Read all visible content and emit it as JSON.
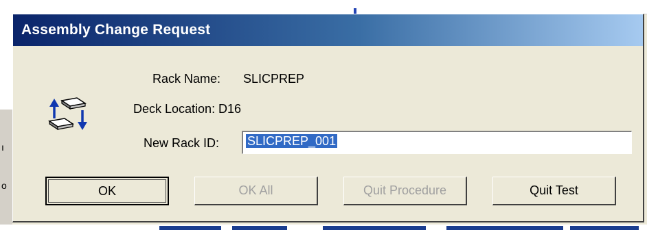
{
  "dialog": {
    "title": "Assembly Change Request",
    "fields": {
      "rack_name_label": "Rack Name:",
      "rack_name_value": "SLICPREP",
      "deck_location_label": "Deck Location:",
      "deck_location_value": "D16",
      "new_rack_id_label": "New Rack ID:",
      "new_rack_id_value": "SLICPREP_001"
    },
    "icon": "rack-swap-icon",
    "buttons": {
      "ok": "OK",
      "ok_all": "OK All",
      "quit_procedure": "Quit Procedure",
      "quit_test": "Quit Test"
    },
    "button_states": {
      "ok_all": "disabled",
      "quit_procedure": "disabled"
    }
  },
  "background": {
    "left_fragments": [
      "ı",
      "o"
    ]
  },
  "colors": {
    "titlebar_start": "#0a246a",
    "titlebar_end": "#a6caf0",
    "selection": "#316ac5",
    "face": "#ece9d8"
  }
}
